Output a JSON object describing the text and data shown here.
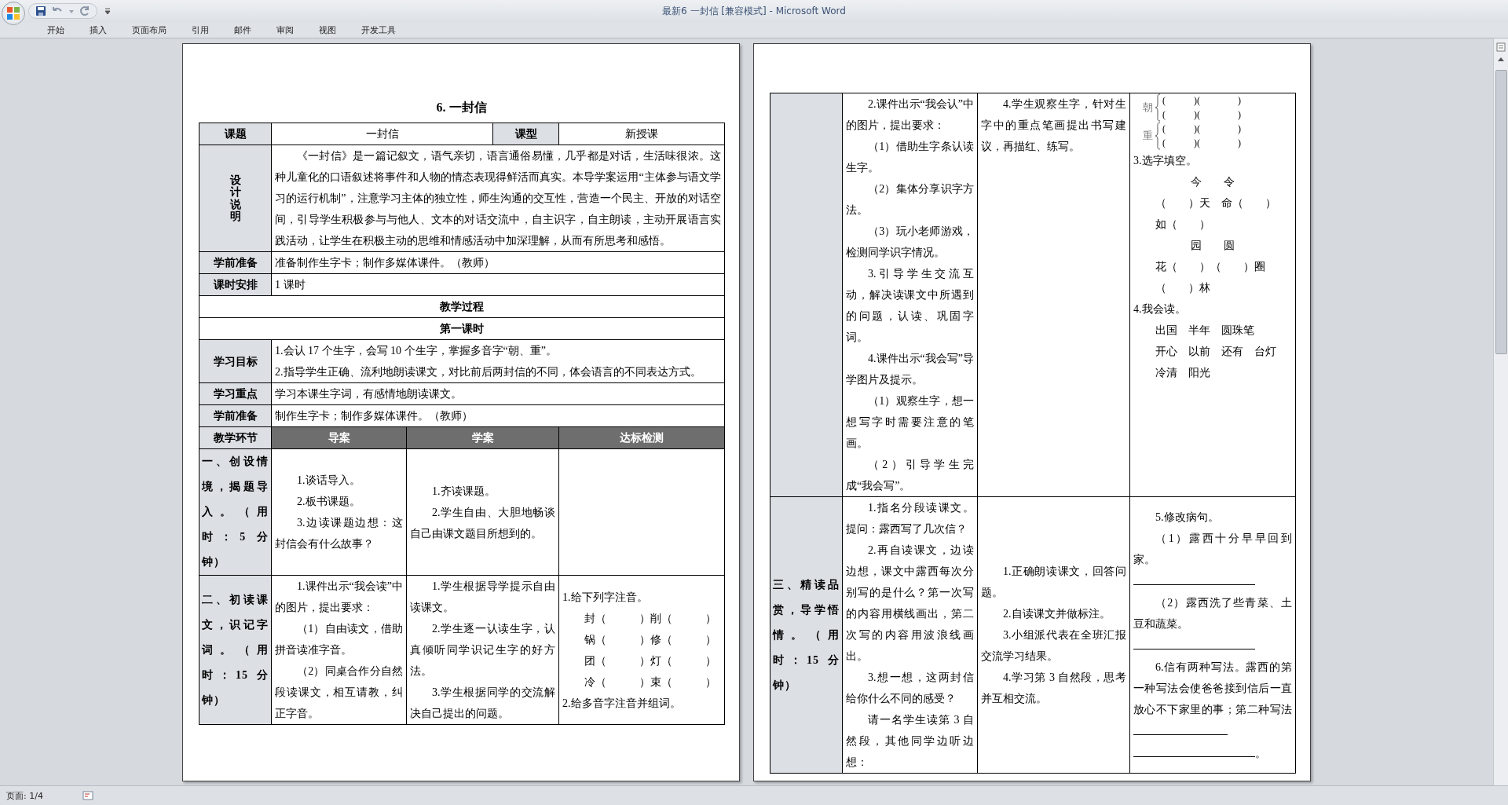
{
  "window": {
    "title": "最新6 一封信 [兼容模式] - Microsoft Word"
  },
  "ribbon_tabs": [
    {
      "label": "开始",
      "selected": false
    },
    {
      "label": "插入",
      "selected": false
    },
    {
      "label": "页面布局",
      "selected": false
    },
    {
      "label": "引用",
      "selected": false
    },
    {
      "label": "邮件",
      "selected": false
    },
    {
      "label": "审阅",
      "selected": false
    },
    {
      "label": "视图",
      "selected": false
    },
    {
      "label": "开发工具",
      "selected": false
    }
  ],
  "pages": [
    {
      "title": "6. 一封信",
      "rows": [
        {
          "kind": "info",
          "label": "课题",
          "value": "一封信",
          "label2": "课型",
          "value2": "新授课"
        },
        {
          "kind": "vertical",
          "label": "设计说明",
          "paragraphs": [
            {
              "kind": "indent",
              "text": "《一封信》是一篇记叙文，语气亲切，语言通俗易懂，几乎都是对话，生活味很浓。这种儿童化的口语叙述将事件和人物的情态表现得鲜活而真实。本导学案运用“主体参与语文学习的运行机制”，注意学习主体的独立性，师生沟通的交互性，营造一个民主、开放的对话空间，引导学生积极参与与他人、文本的对话交流中，自主识字，自主朗读，主动开展语言实践活动，让学生在积极主动的思维和情感活动中加深理解，从而有所思考和感悟。"
            }
          ]
        },
        {
          "kind": "labeled",
          "label": "学前准备",
          "paragraphs": [
            {
              "kind": "plain",
              "text": "准备制作生字卡；制作多媒体课件。（教师）"
            }
          ]
        },
        {
          "kind": "labeled",
          "label": "课时安排",
          "paragraphs": [
            {
              "kind": "plain",
              "text": "1 课时"
            }
          ]
        },
        {
          "kind": "heading",
          "text": "教学过程"
        },
        {
          "kind": "heading",
          "text": "第一课时"
        },
        {
          "kind": "labeled",
          "label": "学习目标",
          "paragraphs": [
            {
              "kind": "plain",
              "text": "1.会认 17 个生字，会写 10 个生字，掌握多音字“朝、重”。"
            },
            {
              "kind": "plain",
              "text": "2.指导学生正确、流利地朗读课文，对比前后两封信的不同，体会语言的不同表达方式。"
            }
          ]
        },
        {
          "kind": "labeled",
          "label": "学习重点",
          "paragraphs": [
            {
              "kind": "plain",
              "text": "学习本课生字词，有感情地朗读课文。"
            }
          ]
        },
        {
          "kind": "labeled",
          "label": "学前准备",
          "paragraphs": [
            {
              "kind": "plain",
              "text": "制作生字卡；制作多媒体课件。（教师）"
            }
          ]
        },
        {
          "kind": "columns",
          "label": "教学环节",
          "columns": [
            "导案",
            "学案",
            "达标检测"
          ]
        },
        {
          "kind": "stage",
          "label": "一、创设情境，揭题导入。（用时：5 分钟）",
          "guide": [
            {
              "kind": "indent",
              "text": "1.谈话导入。"
            },
            {
              "kind": "indent",
              "text": "2.板书课题。"
            },
            {
              "kind": "indent",
              "text": "3.边读课题边想：这封信会有什么故事？"
            }
          ],
          "study": [
            {
              "kind": "indent",
              "text": "1.齐读课题。"
            },
            {
              "kind": "indent",
              "text": "2.学生自由、大胆地畅谈自己由课文题目所想到的。"
            }
          ],
          "check": []
        },
        {
          "kind": "stage",
          "label": "二、初读课文，识记字词。（用时：15 分钟）",
          "guide": [
            {
              "kind": "indent",
              "text": "1.课件出示“我会读”中的图片，提出要求："
            },
            {
              "kind": "indent",
              "text": "（1）自由读文，借助拼音读准字音。"
            },
            {
              "kind": "indent",
              "text": "（2）同桌合作分自然段读课文，相互请教，纠正字音。"
            }
          ],
          "study": [
            {
              "kind": "indent",
              "text": "1.学生根据导学提示自由读课文。"
            },
            {
              "kind": "indent",
              "text": "2.学生逐一认读生字，认真倾听同学识记生字的好方法。"
            },
            {
              "kind": "indent",
              "text": "3.学生根据同学的交流解决自己提出的问题。"
            }
          ],
          "check": [
            {
              "kind": "plain",
              "text": "1.给下列字注音。"
            },
            {
              "kind": "indent",
              "text": "封（　　　）削（　　　）"
            },
            {
              "kind": "indent",
              "text": "锅（　　　）修（　　　）"
            },
            {
              "kind": "indent",
              "text": "团（　　　）灯（　　　）"
            },
            {
              "kind": "indent",
              "text": "冷（　　　）束（　　　）"
            },
            {
              "kind": "plain",
              "text": "2.给多音字注音并组词。"
            }
          ]
        }
      ]
    },
    {
      "rows": [
        {
          "kind": "stage",
          "guide": [
            {
              "kind": "indent",
              "text": "2.课件出示“我会认”中的图片，提出要求："
            },
            {
              "kind": "indent",
              "text": "（1）借助生字条认读生字。"
            },
            {
              "kind": "indent",
              "text": "（2）集体分享识字方法。"
            },
            {
              "kind": "indent",
              "text": "（3）玩小老师游戏，检测同学识字情况。"
            },
            {
              "kind": "indent",
              "text": "3.引导学生交流互动，解决读课文中所遇到的问题，认读、巩固字词。"
            },
            {
              "kind": "indent",
              "text": "4.课件出示“我会写”导学图片及提示。"
            },
            {
              "kind": "indent",
              "text": "（1）观察生字，想一想写字时需要注意的笔画。"
            },
            {
              "kind": "indent",
              "text": "（2）引导学生完成“我会写”。"
            }
          ],
          "study": [
            {
              "kind": "indent",
              "text": "4.学生观察生字，针对生字中的重点笔画提出书写建议，再描红、练写。"
            }
          ],
          "check": [
            {
              "kind": "polyphone",
              "char": "朝",
              "rows": [
                "(　　　)(　　　　)",
                "(　　　)(　　　　)"
              ]
            },
            {
              "kind": "polyphone",
              "char": "重",
              "rows": [
                "(　　　)(　　　　)",
                "(　　　)(　　　　)"
              ]
            },
            {
              "kind": "plain",
              "text": "3.选字填空。"
            },
            {
              "kind": "center",
              "text": "今　　令"
            },
            {
              "kind": "indent",
              "text": "（　　）天　命（　　）"
            },
            {
              "kind": "indent",
              "text": "如（　　）"
            },
            {
              "kind": "center",
              "text": "园　　圆"
            },
            {
              "kind": "indent",
              "text": "花（　　）（　　）圈"
            },
            {
              "kind": "indent",
              "text": "（　　）林"
            },
            {
              "kind": "plain",
              "text": "4.我会读。"
            },
            {
              "kind": "indent",
              "text": "出国　半年　圆珠笔"
            },
            {
              "kind": "indent",
              "text": "开心　以前　还有　台灯"
            },
            {
              "kind": "indent",
              "text": "冷清　阳光"
            }
          ]
        },
        {
          "kind": "stage",
          "label": "三、精读品赏，导学悟情。（用时：15 分钟）",
          "guide": [
            {
              "kind": "indent",
              "text": "1.指名分段读课文。提问：露西写了几次信？"
            },
            {
              "kind": "indent",
              "text": "2.再自读课文，边读边想，课文中露西每次分别写的是什么？第一次写的内容用横线画出，第二次写的内容用波浪线画出。"
            },
            {
              "kind": "indent",
              "text": "3.想一想，这两封信给你什么不同的感受？"
            },
            {
              "kind": "indent",
              "text": "请一名学生读第 3 自然段，其他同学边听边想："
            }
          ],
          "study": [
            {
              "kind": "indent",
              "text": "1.正确朗读课文，回答问题。"
            },
            {
              "kind": "indent",
              "text": "2.自读课文并做标注。"
            },
            {
              "kind": "indent",
              "text": "3.小组派代表在全班汇报交流学习结果。"
            },
            {
              "kind": "indent",
              "text": "4.学习第 3 自然段，思考并互相交流。"
            }
          ],
          "check": [
            {
              "kind": "indent",
              "text": "5.修改病句。"
            },
            {
              "kind": "indent",
              "text": "（1）露西十分早早回到家。"
            },
            {
              "kind": "fill"
            },
            {
              "kind": "indent",
              "text": "（2）露西洗了些青菜、土豆和蔬菜。"
            },
            {
              "kind": "fill"
            },
            {
              "kind": "fill",
              "text": "6.信有两种写法。露西的第一种写法会使爸爸接到信后一直放心不下家里的事；第二种写法"
            },
            {
              "kind": "fill",
              "after": "。"
            }
          ]
        }
      ]
    }
  ],
  "status_bar": {
    "page": "页面: 1/4"
  }
}
